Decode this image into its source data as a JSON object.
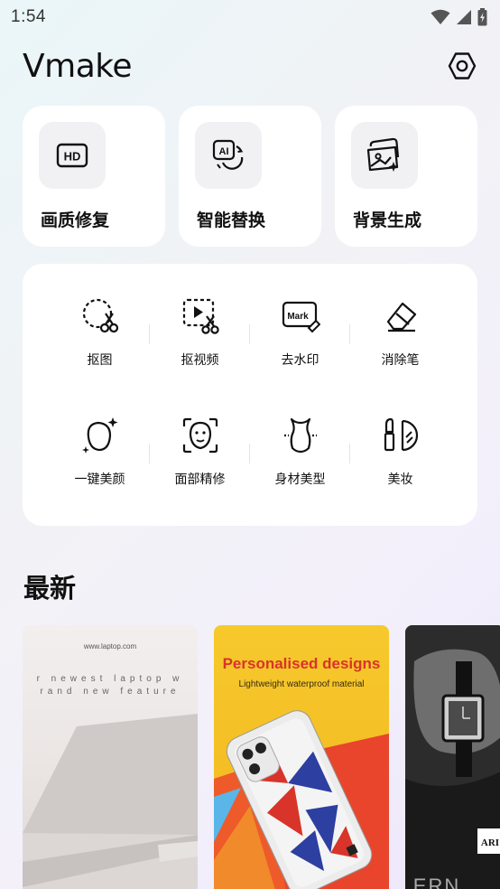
{
  "status_bar": {
    "time": "1:54"
  },
  "header": {
    "app_title": "Vmake"
  },
  "features": [
    {
      "label": "画质修复",
      "icon": "hd-icon"
    },
    {
      "label": "智能替换",
      "icon": "ai-replace-icon"
    },
    {
      "label": "背景生成",
      "icon": "image-generate-icon"
    }
  ],
  "tools": {
    "row1": [
      {
        "label": "抠图",
        "icon": "cutout-scissors-icon"
      },
      {
        "label": "抠视频",
        "icon": "video-cutout-icon"
      },
      {
        "label": "去水印",
        "icon": "watermark-remove-icon"
      },
      {
        "label": "消除笔",
        "icon": "eraser-icon"
      }
    ],
    "row2": [
      {
        "label": "一键美颜",
        "icon": "face-beauty-icon"
      },
      {
        "label": "面部精修",
        "icon": "face-refine-icon"
      },
      {
        "label": "身材美型",
        "icon": "body-shape-icon"
      },
      {
        "label": "美妆",
        "icon": "makeup-icon"
      }
    ]
  },
  "recent": {
    "title": "最新",
    "items": [
      {
        "name": "laptop-thumbnail",
        "url_text": "www.laptop.com",
        "line1": "r newest laptop w",
        "line2": "rand new feature"
      },
      {
        "name": "phone-case-thumbnail",
        "headline": "Personalised designs",
        "subline": "Lightweight waterproof material"
      },
      {
        "name": "watch-thumbnail",
        "badge": "ARI",
        "bottom_text": "ERN"
      }
    ]
  }
}
